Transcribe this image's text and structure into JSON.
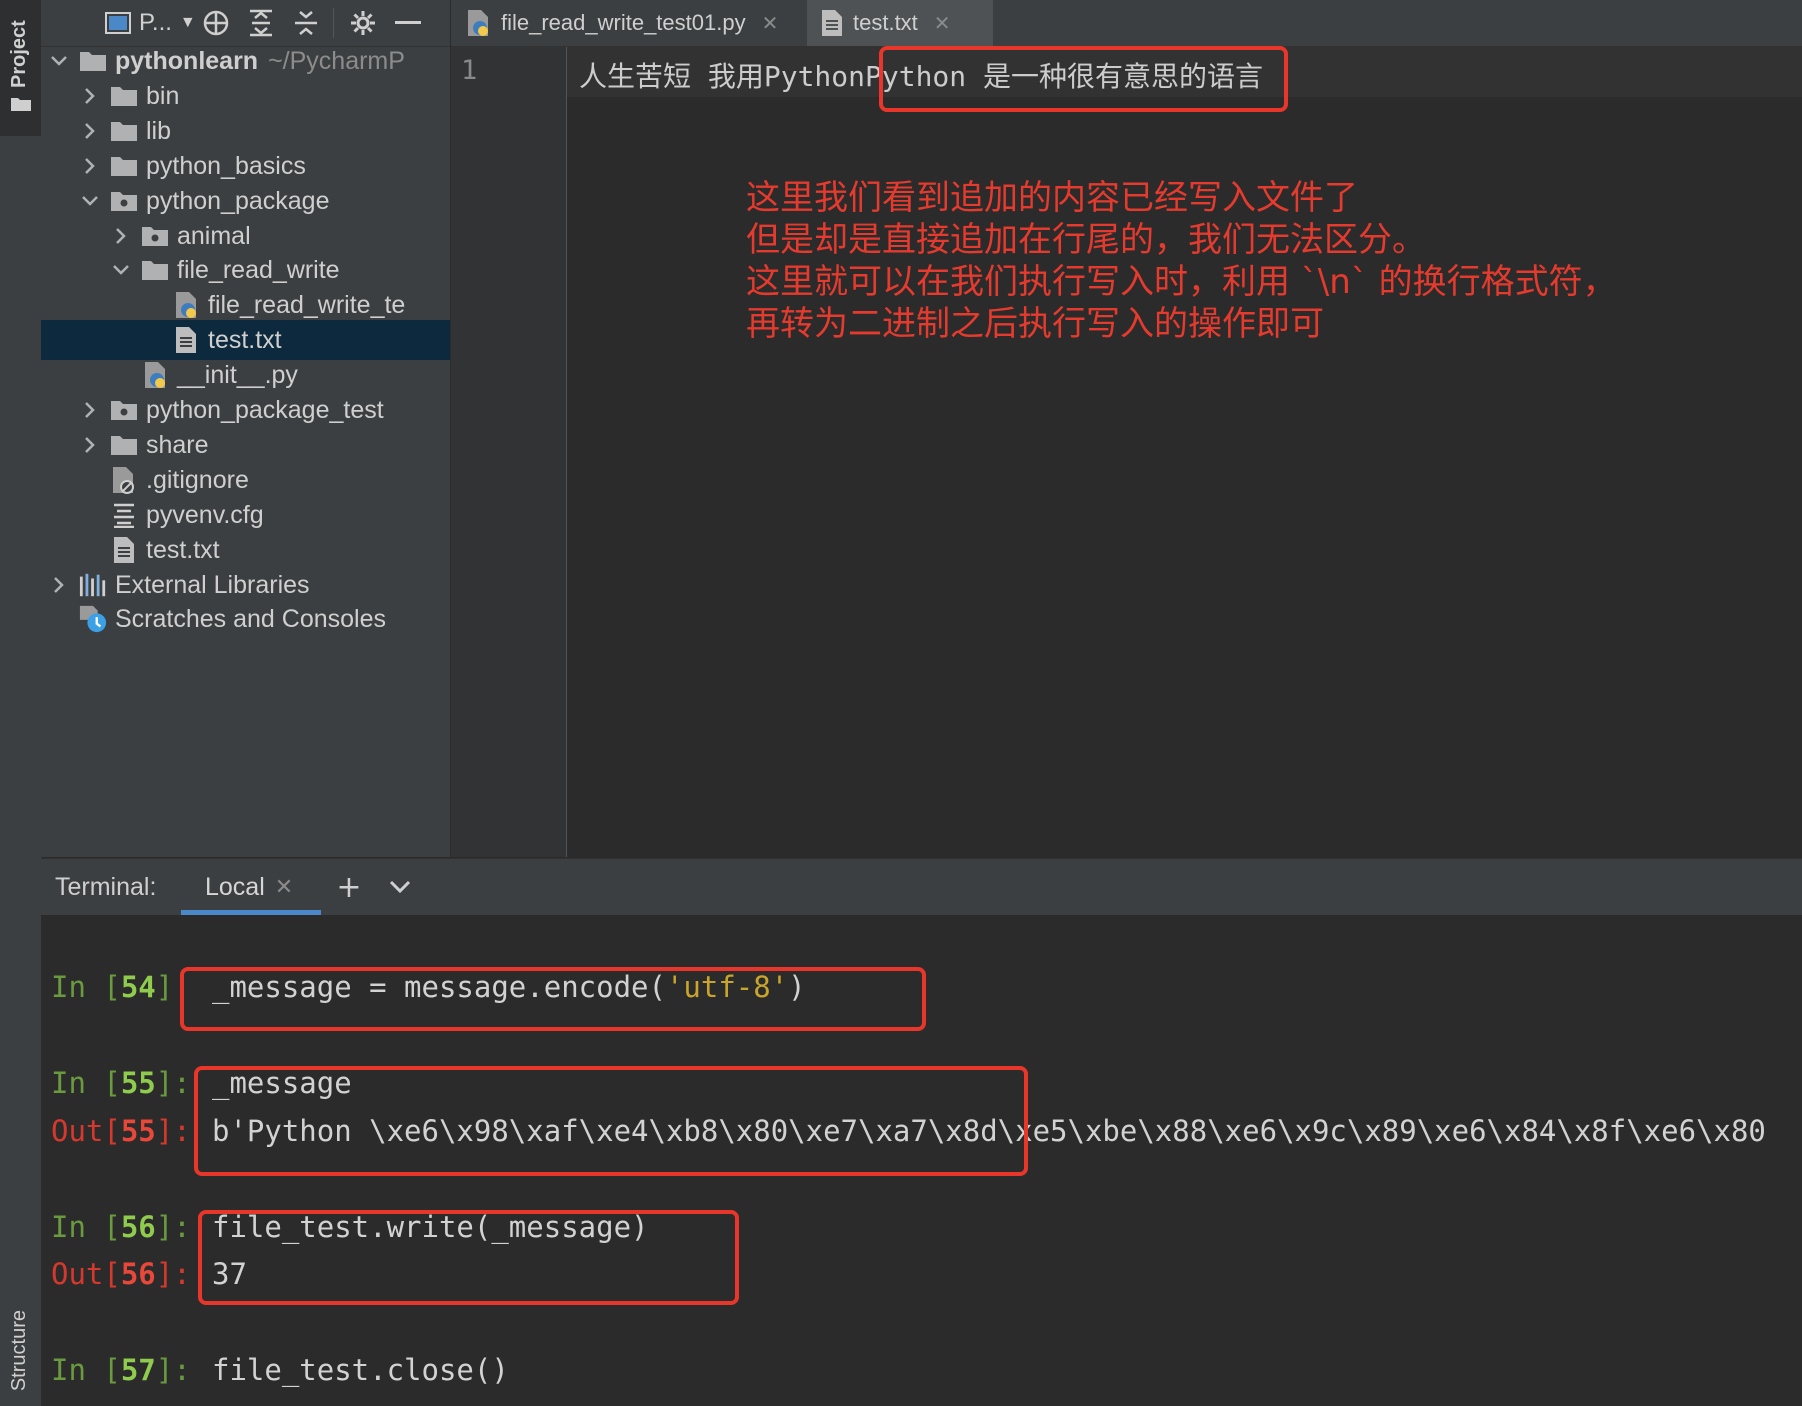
{
  "sidebar": {
    "project_tab_label": "Project",
    "structure_tab_label": "Structure"
  },
  "project_toolbar": {
    "title": "P...",
    "dropdown_icon": "chevron-down-icon",
    "icons": [
      "locate-icon",
      "expand-all-icon",
      "collapse-all-icon",
      "gear-icon",
      "minimize-icon"
    ]
  },
  "project_tree": {
    "items": [
      {
        "label": "pythonlearn",
        "suffix": "~/PycharmP",
        "depth": 0,
        "expanded": true,
        "type": "folder"
      },
      {
        "label": "bin",
        "depth": 1,
        "expanded": false,
        "type": "folder"
      },
      {
        "label": "lib",
        "depth": 1,
        "expanded": false,
        "type": "folder"
      },
      {
        "label": "python_basics",
        "depth": 1,
        "expanded": false,
        "type": "folder"
      },
      {
        "label": "python_package",
        "depth": 1,
        "expanded": true,
        "type": "package"
      },
      {
        "label": "animal",
        "depth": 2,
        "expanded": false,
        "type": "package"
      },
      {
        "label": "file_read_write",
        "depth": 2,
        "expanded": true,
        "type": "folder"
      },
      {
        "label": "file_read_write_te",
        "depth": 3,
        "type": "python-file"
      },
      {
        "label": "test.txt",
        "depth": 3,
        "type": "text-file",
        "selected": true
      },
      {
        "label": "__init__.py",
        "depth": 2,
        "type": "python-file"
      },
      {
        "label": "python_package_test",
        "depth": 1,
        "expanded": false,
        "type": "package"
      },
      {
        "label": "share",
        "depth": 1,
        "expanded": false,
        "type": "folder"
      },
      {
        "label": ".gitignore",
        "depth": 1,
        "type": "gitignore-file"
      },
      {
        "label": "pyvenv.cfg",
        "depth": 1,
        "type": "config-file"
      },
      {
        "label": "test.txt",
        "depth": 1,
        "type": "text-file"
      },
      {
        "label": "External Libraries",
        "depth": 0,
        "expanded": false,
        "type": "libraries"
      },
      {
        "label": "Scratches and Consoles",
        "depth": 0,
        "type": "scratches"
      }
    ]
  },
  "editor_tabs": [
    {
      "label": "file_read_write_test01.py",
      "icon": "python-file-icon",
      "active": false
    },
    {
      "label": "test.txt",
      "icon": "text-file-icon",
      "active": true
    }
  ],
  "editor": {
    "line_number": "1",
    "content": "人生苦短 我用PythonPython 是一种很有意思的语言",
    "annotation_lines": [
      "这里我们看到追加的内容已经写入文件了",
      "但是却是直接追加在行尾的，我们无法区分。",
      "这里就可以在我们执行写入时，利用 `\\n` 的换行格式符，",
      "再转为二进制之后执行写入的操作即可"
    ]
  },
  "terminal": {
    "label": "Terminal:",
    "tab_label": "Local",
    "lines": [
      {
        "kind": "in",
        "prefix": "In [",
        "num": "54",
        "suffix": "]:",
        "code": " _message = message.encode(",
        "str": "'utf-8'",
        "code_after": ")"
      },
      {
        "kind": "in",
        "prefix": "In [",
        "num": "55",
        "suffix": "]:",
        "code": " _message"
      },
      {
        "kind": "out",
        "prefix": "Out[",
        "num": "55",
        "suffix": "]:",
        "code": " b'Python \\xe6\\x98\\xaf\\xe4\\xb8\\x80\\xe7\\xa7\\x8d\\xe5\\xbe\\x88\\xe6\\x9c\\x89\\xe6\\x84\\x8f\\xe6\\x80"
      },
      {
        "kind": "in",
        "prefix": "In [",
        "num": "56",
        "suffix": "]:",
        "code": " file_test.write(_message)"
      },
      {
        "kind": "out",
        "prefix": "Out[",
        "num": "56",
        "suffix": "]:",
        "code": " 37"
      },
      {
        "kind": "in",
        "prefix": "In [",
        "num": "57",
        "suffix": "]:",
        "code": " file_test.close()"
      }
    ]
  },
  "colors": {
    "annotation": "#e53a2e",
    "selection": "#0d293e",
    "tab_underline": "#4a88c7",
    "in_prompt": "#8fcc4e",
    "out_prompt": "#e8483a",
    "string": "#c9a52b"
  }
}
